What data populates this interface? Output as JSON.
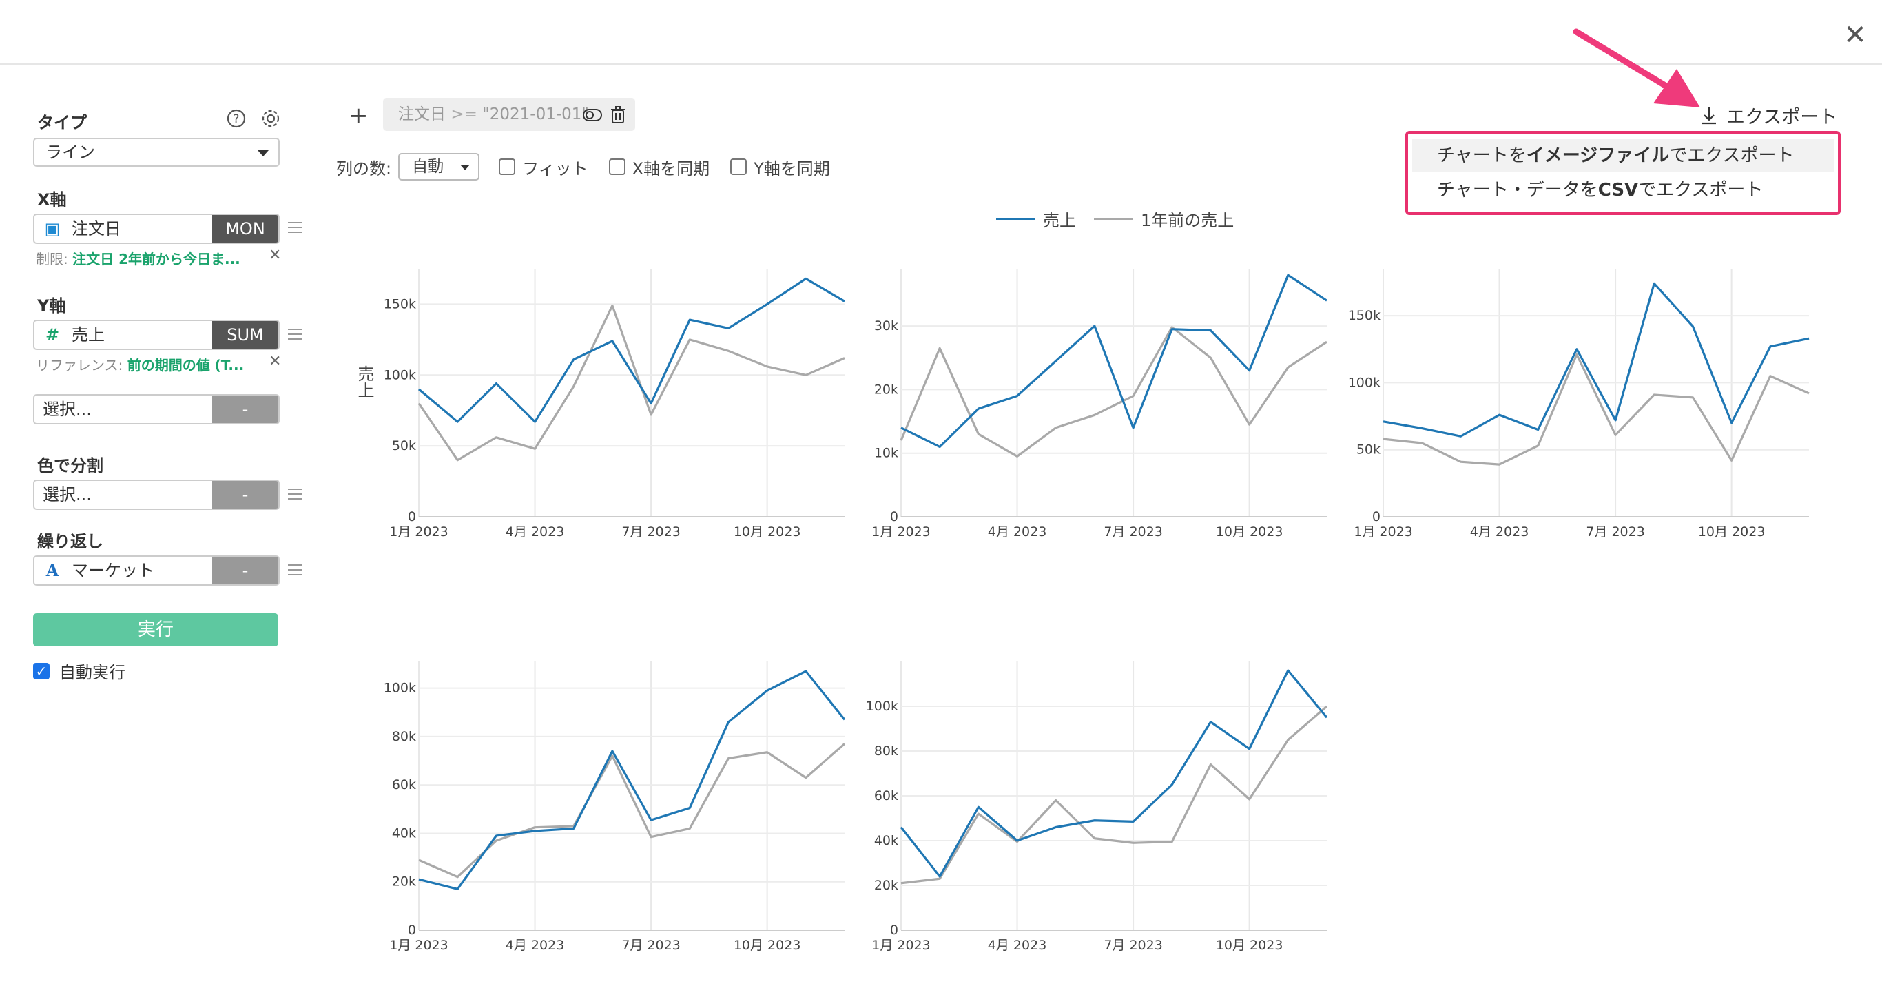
{
  "window": {
    "close_label": "✕"
  },
  "sidebar": {
    "type_title": "タイプ",
    "type_value": "ライン",
    "x_title": "X軸",
    "x_field": "注文日",
    "x_tag": "MON",
    "x_note_prefix": "制限: ",
    "x_note_value": "注文日 2年前から今日ま...",
    "y_title": "Y軸",
    "y_field": "売上",
    "y_tag": "SUM",
    "y_note_prefix": "リファレンス: ",
    "y_note_value": "前の期間の値 (T...",
    "extra_placeholder": "選択...",
    "extra_tag": "-",
    "color_title": "色で分割",
    "color_placeholder": "選択...",
    "color_tag": "-",
    "repeat_title": "繰り返し",
    "repeat_field": "マーケット",
    "repeat_tag": "-",
    "run_label": "実行",
    "autorun_label": "自動実行"
  },
  "toolbar": {
    "filter_field": "注文日",
    "filter_op": ">=",
    "filter_value": "\"2021-01-01\"",
    "columns_label": "列の数:",
    "columns_value": "自動",
    "fit_label": "フィット",
    "sync_x_label": "X軸を同期",
    "sync_y_label": "Y軸を同期"
  },
  "export": {
    "button_label": "エクスポート",
    "menu": [
      {
        "pre": "チャートを",
        "bold": "イメージファイル",
        "post": "でエクスポート"
      },
      {
        "pre": "チャート・データを",
        "bold": "CSV",
        "post": "でエクスポート"
      }
    ]
  },
  "colors": {
    "current": "#1f77b4",
    "previous": "#a9a9a9",
    "accent": "#e8316e",
    "run": "#5ec8a0"
  },
  "chart_data": [
    {
      "type": "line",
      "ylabel": "売上",
      "x": [
        "1月 2023",
        "2月 2023",
        "3月 2023",
        "4月 2023",
        "5月 2023",
        "6月 2023",
        "7月 2023",
        "8月 2023",
        "9月 2023",
        "10月 2023",
        "11月 2023",
        "12月 2023"
      ],
      "xticks": [
        "1月 2023",
        "4月 2023",
        "7月 2023",
        "10月 2023"
      ],
      "yticks": [
        "0",
        "50k",
        "100k",
        "150k"
      ],
      "ylim": [
        0,
        175000
      ],
      "series": [
        {
          "name": "売上",
          "values": [
            90000,
            67000,
            94000,
            67000,
            111000,
            124000,
            80000,
            139000,
            133000,
            150000,
            168000,
            152000
          ]
        },
        {
          "name": "1年前の売上",
          "values": [
            80000,
            40000,
            56000,
            48000,
            92000,
            149000,
            72000,
            125000,
            117000,
            106000,
            100000,
            112000
          ]
        }
      ]
    },
    {
      "type": "line",
      "x": [
        "1月 2023",
        "2月 2023",
        "3月 2023",
        "4月 2023",
        "5月 2023",
        "6月 2023",
        "7月 2023",
        "8月 2023",
        "9月 2023",
        "10月 2023",
        "11月 2023",
        "12月 2023"
      ],
      "xticks": [
        "1月 2023",
        "4月 2023",
        "7月 2023",
        "10月 2023"
      ],
      "yticks": [
        "0",
        "10k",
        "20k",
        "30k"
      ],
      "ylim": [
        0,
        39000
      ],
      "series": [
        {
          "name": "売上",
          "values": [
            14000,
            11000,
            17000,
            19000,
            24500,
            30000,
            14000,
            29500,
            29300,
            23000,
            38000,
            34000
          ]
        },
        {
          "name": "1年前の売上",
          "values": [
            12000,
            26500,
            13000,
            9500,
            14000,
            16000,
            19000,
            29800,
            25000,
            14500,
            23500,
            27500
          ]
        }
      ]
    },
    {
      "type": "line",
      "x": [
        "1月 2023",
        "2月 2023",
        "3月 2023",
        "4月 2023",
        "5月 2023",
        "6月 2023",
        "7月 2023",
        "8月 2023",
        "9月 2023",
        "10月 2023",
        "11月 2023",
        "12月 2023"
      ],
      "xticks": [
        "1月 2023",
        "4月 2023",
        "7月 2023",
        "10月 2023"
      ],
      "yticks": [
        "0",
        "50k",
        "100k",
        "150k"
      ],
      "ylim": [
        0,
        185000
      ],
      "series": [
        {
          "name": "売上",
          "values": [
            71000,
            66000,
            60000,
            76000,
            65000,
            125000,
            72000,
            174000,
            142000,
            70000,
            127000,
            133000
          ]
        },
        {
          "name": "1年前の売上",
          "values": [
            58000,
            55000,
            41000,
            39000,
            53000,
            121000,
            61000,
            91000,
            89000,
            42000,
            105000,
            92000
          ]
        }
      ]
    },
    {
      "type": "line",
      "x": [
        "1月 2023",
        "2月 2023",
        "3月 2023",
        "4月 2023",
        "5月 2023",
        "6月 2023",
        "7月 2023",
        "8月 2023",
        "9月 2023",
        "10月 2023",
        "11月 2023",
        "12月 2023"
      ],
      "xticks": [
        "1月 2023",
        "4月 2023",
        "7月 2023",
        "10月 2023"
      ],
      "yticks": [
        "0",
        "20k",
        "40k",
        "60k",
        "80k",
        "100k"
      ],
      "ylim": [
        0,
        111000
      ],
      "series": [
        {
          "name": "売上",
          "values": [
            21000,
            17000,
            39000,
            41000,
            42000,
            74000,
            45500,
            50500,
            86000,
            99000,
            107000,
            87000
          ]
        },
        {
          "name": "1年前の売上",
          "values": [
            29000,
            22000,
            37000,
            42500,
            43000,
            72000,
            38500,
            42000,
            71000,
            73500,
            63000,
            77000
          ]
        }
      ]
    },
    {
      "type": "line",
      "x": [
        "1月 2023",
        "2月 2023",
        "3月 2023",
        "4月 2023",
        "5月 2023",
        "6月 2023",
        "7月 2023",
        "8月 2023",
        "9月 2023",
        "10月 2023",
        "11月 2023",
        "12月 2023"
      ],
      "xticks": [
        "1月 2023",
        "4月 2023",
        "7月 2023",
        "10月 2023"
      ],
      "yticks": [
        "0",
        "20k",
        "40k",
        "60k",
        "80k",
        "100k"
      ],
      "ylim": [
        0,
        120000
      ],
      "series": [
        {
          "name": "売上",
          "values": [
            46000,
            24000,
            55000,
            40000,
            46000,
            49000,
            48500,
            65000,
            93000,
            81000,
            116000,
            95000
          ]
        },
        {
          "name": "1年前の売上",
          "values": [
            21000,
            23000,
            52000,
            39500,
            58000,
            41000,
            39000,
            39500,
            74000,
            58500,
            85000,
            100000
          ]
        }
      ]
    }
  ]
}
